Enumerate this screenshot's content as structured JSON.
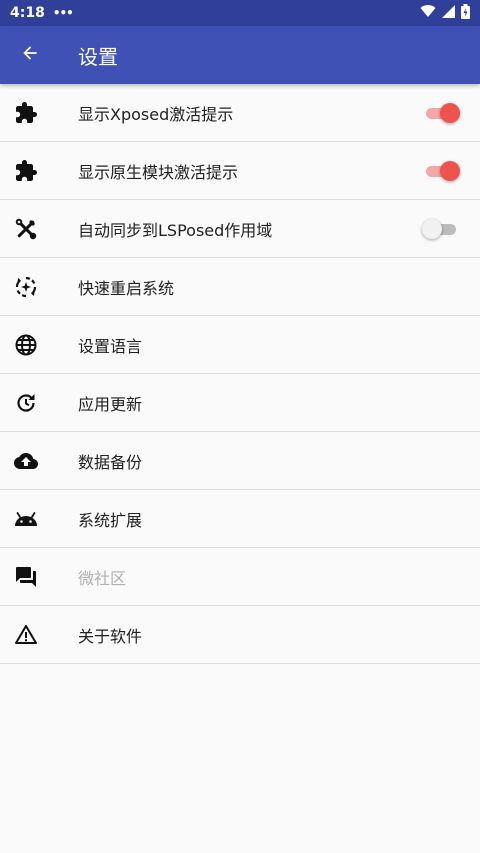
{
  "status_bar": {
    "time": "4:18",
    "more": "•••"
  },
  "appbar": {
    "title": "设置"
  },
  "items": [
    {
      "label": "显示Xposed激活提示",
      "icon": "puzzle-icon",
      "toggle": true
    },
    {
      "label": "显示原生模块激活提示",
      "icon": "puzzle-icon",
      "toggle": true
    },
    {
      "label": "自动同步到LSPosed作用域",
      "icon": "tools-icon",
      "toggle": false
    },
    {
      "label": "快速重启系统",
      "icon": "restart-icon"
    },
    {
      "label": "设置语言",
      "icon": "globe-icon"
    },
    {
      "label": "应用更新",
      "icon": "update-icon"
    },
    {
      "label": "数据备份",
      "icon": "cloud-upload-icon"
    },
    {
      "label": "系统扩展",
      "icon": "android-icon"
    },
    {
      "label": "微社区",
      "icon": "forum-icon",
      "disabled": true
    },
    {
      "label": "关于软件",
      "icon": "warning-icon"
    }
  ],
  "colors": {
    "appbar": "#3f51b5",
    "status_bar": "#2f3f9a",
    "switch_on": "#ef5350"
  }
}
